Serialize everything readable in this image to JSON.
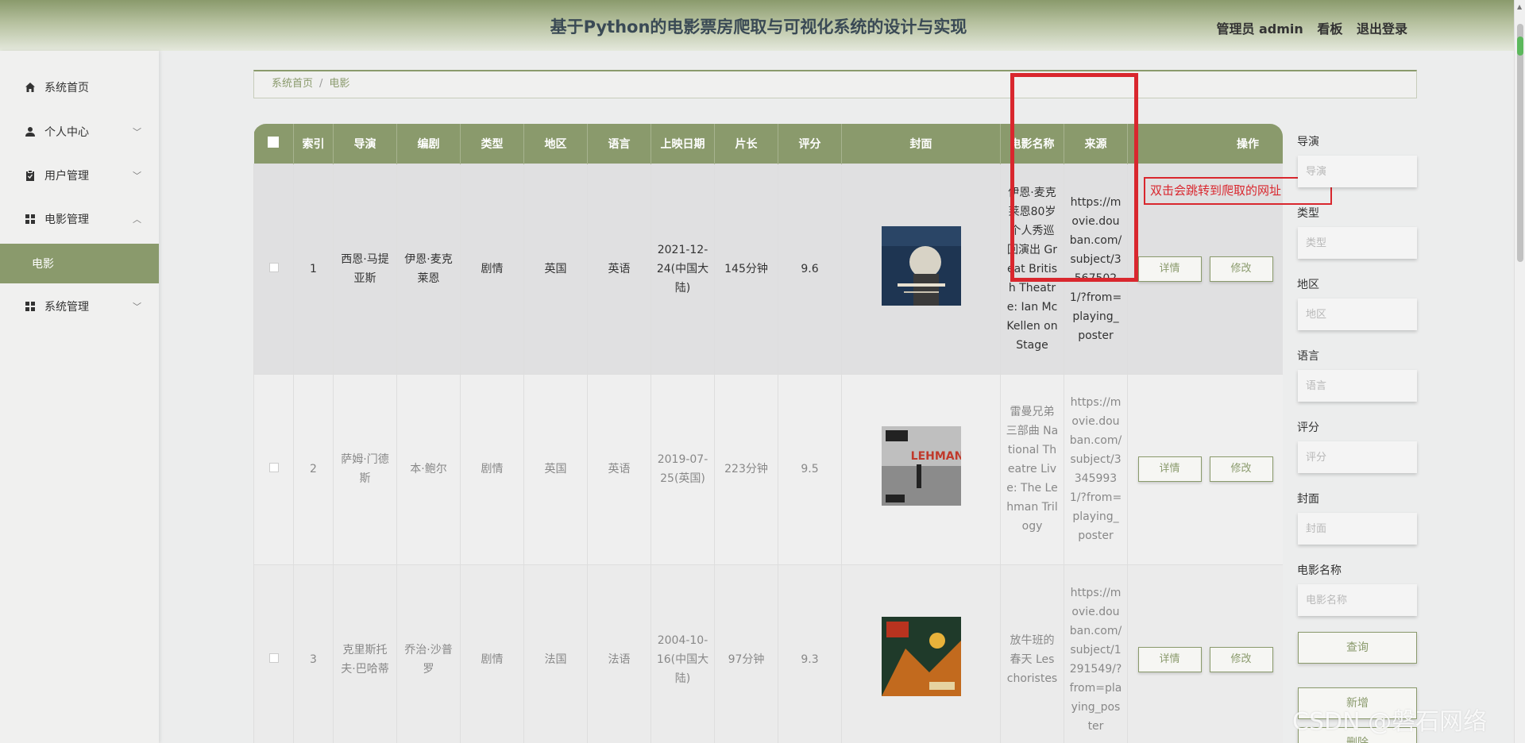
{
  "header": {
    "title": "基于Python的电影票房爬取与可视化系统的设计与实现",
    "user": "管理员 admin",
    "board": "看板",
    "logout": "退出登录"
  },
  "sidebar": {
    "items": [
      {
        "label": "系统首页",
        "icon": "home-icon"
      },
      {
        "label": "个人中心",
        "icon": "user-icon"
      },
      {
        "label": "用户管理",
        "icon": "clipboard-icon"
      },
      {
        "label": "电影管理",
        "icon": "grid-icon"
      },
      {
        "label": "电影",
        "icon": ""
      },
      {
        "label": "系统管理",
        "icon": "grid-icon"
      }
    ]
  },
  "breadcrumb": {
    "home": "系统首页",
    "sep": "/",
    "current": "电影"
  },
  "table": {
    "headers": [
      "索引",
      "导演",
      "编剧",
      "类型",
      "地区",
      "语言",
      "上映日期",
      "片长",
      "评分",
      "封面",
      "电影名称",
      "来源",
      "操作"
    ],
    "rows": [
      {
        "index": "1",
        "director": "西恩·马提亚斯",
        "writer": "伊恩·麦克莱恩",
        "genre": "剧情",
        "region": "英国",
        "language": "英语",
        "date": "2021-12-24(中国大陆)",
        "duration": "145分钟",
        "score": "9.6",
        "name": "伊恩·麦克莱恩80岁个人秀巡回演出 Great British Theatre: Ian McKellen on Stage",
        "source": "https://movie.douban.com/subject/35675021/?from=playing_poster"
      },
      {
        "index": "2",
        "director": "萨姆·门德斯",
        "writer": "本·鲍尔",
        "genre": "剧情",
        "region": "英国",
        "language": "英语",
        "date": "2019-07-25(英国)",
        "duration": "223分钟",
        "score": "9.5",
        "name": "雷曼兄弟三部曲 National Theatre Live: The Lehman Trilogy",
        "source": "https://movie.douban.com/subject/33459931/?from=playing_poster"
      },
      {
        "index": "3",
        "director": "克里斯托夫·巴哈蒂",
        "writer": "乔治·沙普罗",
        "genre": "剧情",
        "region": "法国",
        "language": "法语",
        "date": "2004-10-16(中国大陆)",
        "duration": "97分钟",
        "score": "9.3",
        "name": "放牛班的春天 Les choristes",
        "source": "https://movie.douban.com/subject/1291549/?from=playing_poster"
      }
    ],
    "detail_label": "详情",
    "edit_label": "修改"
  },
  "annotation": {
    "tip": "双击会跳转到爬取的网址"
  },
  "filters": {
    "fields": [
      {
        "label": "导演",
        "placeholder": "导演"
      },
      {
        "label": "类型",
        "placeholder": "类型"
      },
      {
        "label": "地区",
        "placeholder": "地区"
      },
      {
        "label": "语言",
        "placeholder": "语言"
      },
      {
        "label": "评分",
        "placeholder": "评分"
      },
      {
        "label": "封面",
        "placeholder": "封面"
      },
      {
        "label": "电影名称",
        "placeholder": "电影名称"
      }
    ],
    "query": "查询",
    "add": "新增",
    "delete": "删除"
  },
  "watermark": "CSDN @磐石网络",
  "colors": {
    "accent": "#8a9a6c",
    "annotation": "#d9272e"
  }
}
